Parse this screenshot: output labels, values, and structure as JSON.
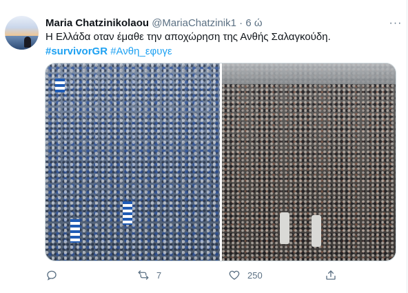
{
  "tweet": {
    "author_name": "Maria Chatzinikolaou",
    "author_handle": "@MariaChatzinik1",
    "separator": "·",
    "time": "6 ώ",
    "more_label": "···",
    "text": "Η Ελλάδα οταν έμαθε την αποχώρηση της Ανθής Σαλαγκούδη.",
    "hashtags": [
      "#survivorGR",
      "#Ανθη_εφυγε"
    ]
  },
  "media": {
    "left_photo": "crowd-with-greek-flags",
    "right_photo": "crowd-in-city-square"
  },
  "actions": {
    "reply_icon": "reply-icon",
    "retweet_icon": "retweet-icon",
    "retweet_count": "7",
    "like_icon": "like-icon",
    "like_count": "250",
    "share_icon": "share-icon"
  },
  "colors": {
    "link": "#1da1f2",
    "muted": "#5b7083",
    "text": "#0f1419"
  }
}
